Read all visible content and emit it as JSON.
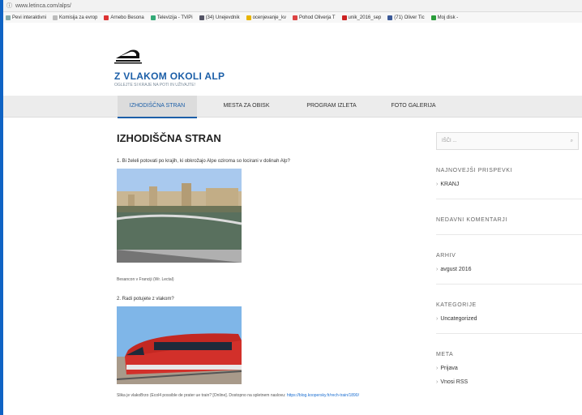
{
  "browser": {
    "url": "www.letinca.com/alps/",
    "bookmarks": [
      {
        "label": "Pevi interaktivni",
        "color": "#8aa"
      },
      {
        "label": "Komisija za evrop",
        "color": "#bbb"
      },
      {
        "label": "Arnebo Besona",
        "color": "#d33"
      },
      {
        "label": "Televizija - TViPi",
        "color": "#3a7"
      },
      {
        "label": "(34) Unejevdnik",
        "color": "#556"
      },
      {
        "label": "ocenjevanje_kv",
        "color": "#e8b400"
      },
      {
        "label": "Pohod Oliverja T",
        "color": "#d44"
      },
      {
        "label": "unik_2016_sep",
        "color": "#c22"
      },
      {
        "label": "(71) Oliver Tic",
        "color": "#3b5998"
      },
      {
        "label": "Moj disk -",
        "color": "#2a9d3a"
      }
    ]
  },
  "site": {
    "title": "Z VLAKOM OKOLI ALP",
    "tagline": "OGLEJTE SI KRAJE NA POTI IN UŽIVAJTE!"
  },
  "nav": [
    {
      "label": "IZHODIŠČNA STRAN",
      "active": true
    },
    {
      "label": "MESTA ZA OBISK",
      "active": false
    },
    {
      "label": "PROGRAM IZLETA",
      "active": false
    },
    {
      "label": "FOTO GALERIJA",
      "active": false
    }
  ],
  "main": {
    "title": "IZHODIŠČNA STRAN",
    "q1": "1. Bi želeli potovati po krajih, ki obkrožajo Alpe oziroma so locirani v dolinah Alp?",
    "caption1": "Besancon v Franciji (Wr. Lectal)",
    "q2": "2. Radi potujete z vlakom?",
    "source_text": "Slika je vlakoBrzo (Ecol4 possible de prater ue train? [Online]. Dostopno na spletnem naslovu:",
    "source_link": "https://blog.koopersky.fr/rech-train/1890/"
  },
  "sidebar": {
    "search_placeholder": "IŠČI ...",
    "recent_posts_title": "NAJNOVEJŠI PRISPEVKI",
    "recent_posts": [
      "KRANJ"
    ],
    "recent_comments_title": "NEDAVNI KOMENTARJI",
    "archive_title": "ARHIV",
    "archive": [
      "avgust 2016"
    ],
    "categories_title": "KATEGORIJE",
    "categories": [
      "Uncategorized"
    ],
    "meta_title": "META",
    "meta": [
      "Prijava",
      "Vnosi RSS"
    ]
  }
}
